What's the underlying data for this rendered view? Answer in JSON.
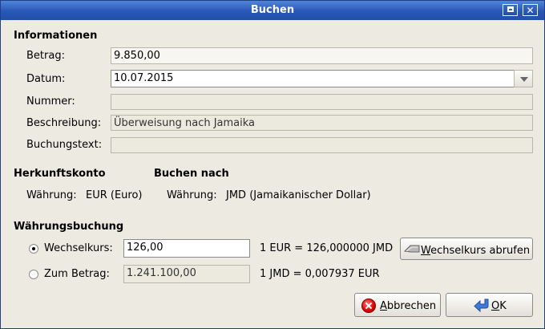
{
  "window": {
    "title": "Buchen"
  },
  "informationen": {
    "heading": "Informationen",
    "betrag": {
      "label": "Betrag:",
      "value": "9.850,00"
    },
    "datum": {
      "label": "Datum:",
      "value": "10.07.2015"
    },
    "nummer": {
      "label": "Nummer:",
      "value": ""
    },
    "beschreibung": {
      "label": "Beschreibung:",
      "value": "Überweisung nach Jamaika"
    },
    "buchungstext": {
      "label": "Buchungstext:",
      "value": ""
    }
  },
  "herkunftskonto": {
    "heading": "Herkunftskonto",
    "currency_label": "Währung:",
    "currency_value": "EUR (Euro)"
  },
  "buchen_nach": {
    "heading": "Buchen nach",
    "currency_label": "Währung:",
    "currency_value": "JMD (Jamaikanischer Dollar)"
  },
  "waehrungsbuchung": {
    "heading": "Währungsbuchung",
    "wechselkurs": {
      "label": "Wechselkurs:",
      "value": "126,00",
      "conversion": "1 EUR = 126,000000 JMD",
      "selected": true
    },
    "zum_betrag": {
      "label": "Zum Betrag:",
      "value": "1.241.100,00",
      "conversion": "1 JMD = 0,007937 EUR",
      "selected": false
    },
    "fetch_button": {
      "mnemonic": "W",
      "rest": "echselkurs abrufen"
    }
  },
  "buttons": {
    "cancel": {
      "mnemonic": "A",
      "rest": "bbrechen"
    },
    "ok": {
      "mnemonic": "O",
      "rest": "K"
    }
  },
  "icons": {
    "window_maximize": "maximize-icon",
    "window_close": "close-icon",
    "combo": "chevron-down-icon",
    "exchange": "exchange-icon",
    "cancel": "cancel-icon",
    "ok": "return-arrow-icon"
  },
  "colors": {
    "titlebar": "#2857b8",
    "window_bg": "#edeae2",
    "cancel_icon": "#d90000",
    "ok_icon": "#3d7ad9"
  }
}
